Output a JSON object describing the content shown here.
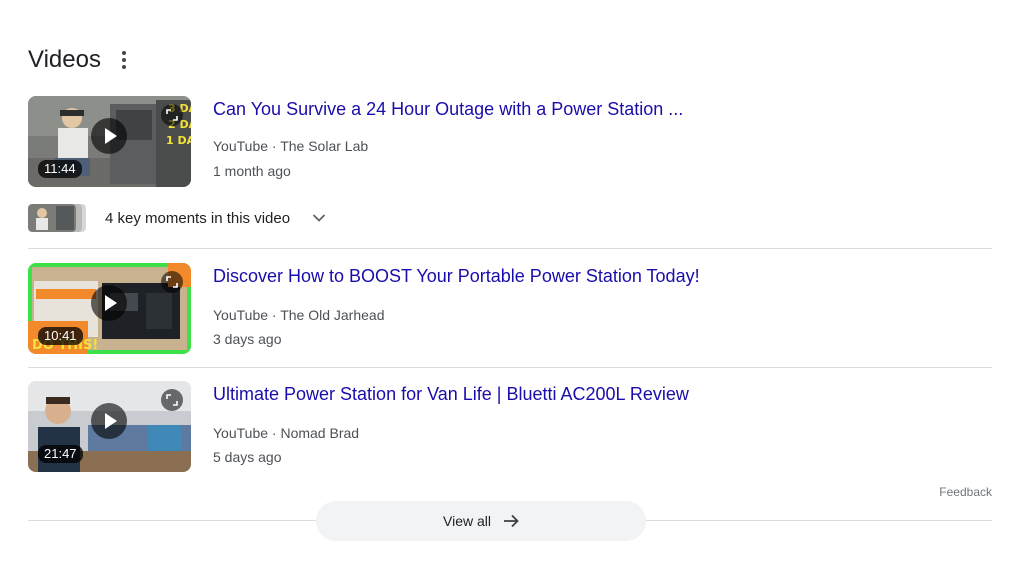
{
  "header": {
    "title": "Videos",
    "more_icon": "more-vertical-icon"
  },
  "videos": [
    {
      "title": "Can You Survive a 24 Hour Outage with a Power Station ...",
      "source": "YouTube · The Solar Lab",
      "date": "1 month ago",
      "duration": "11:44"
    },
    {
      "title": "Discover How to BOOST Your Portable Power Station Today!",
      "source": "YouTube · The Old Jarhead",
      "date": "3 days ago",
      "duration": "10:41"
    },
    {
      "title": "Ultimate Power Station for Van Life | Bluetti AC200L Review",
      "source": "YouTube · Nomad Brad",
      "date": "5 days ago",
      "duration": "21:47"
    }
  ],
  "key_moments": {
    "label": "4 key moments in this video",
    "icon": "chevron-down-icon"
  },
  "feedback": "Feedback",
  "view_all": {
    "label": "View all",
    "icon": "arrow-right-icon"
  },
  "colors": {
    "link": "#1a0dab",
    "secondary_text": "#4d5156",
    "divider": "#dadce0",
    "pill_bg": "#f1f3f4"
  }
}
